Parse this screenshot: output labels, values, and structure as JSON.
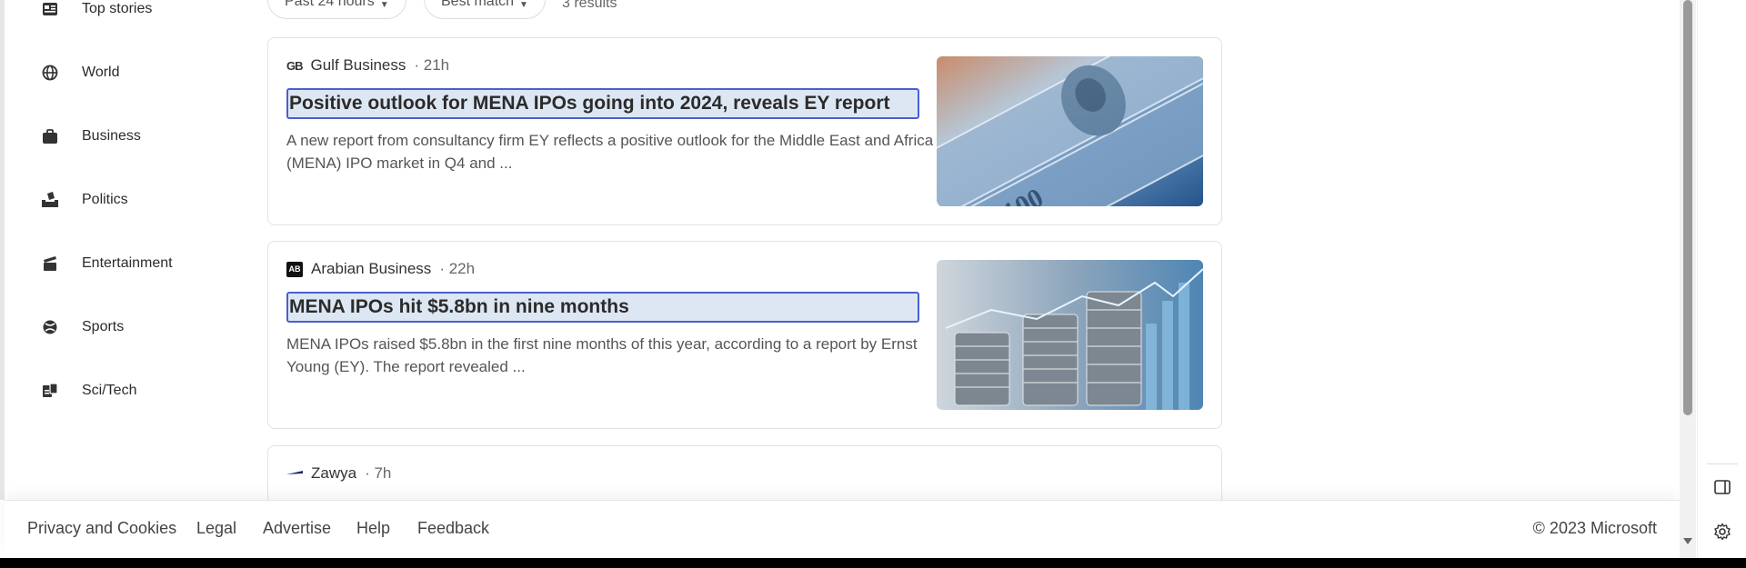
{
  "sidebar": {
    "items": [
      {
        "label": "Top stories",
        "icon": "newspaper-icon"
      },
      {
        "label": "World",
        "icon": "globe-icon"
      },
      {
        "label": "Business",
        "icon": "briefcase-icon"
      },
      {
        "label": "Politics",
        "icon": "ballot-box-icon"
      },
      {
        "label": "Entertainment",
        "icon": "clapperboard-icon"
      },
      {
        "label": "Sports",
        "icon": "sports-ball-icon"
      },
      {
        "label": "Sci/Tech",
        "icon": "flask-icon"
      }
    ]
  },
  "filters": {
    "time": "Past 24 hours",
    "sort": "Best match",
    "results": "3 results"
  },
  "articles": [
    {
      "source": "Gulf Business",
      "source_logo": "GB",
      "time": "· 21h",
      "title": "Positive outlook for MENA IPOs going into 2024, reveals EY report",
      "snippet": "A new report from consultancy firm EY reflects a positive outlook for the Middle East and Africa (MENA) IPO market in Q4 and ...",
      "thumbnail": "dollar-bills-image"
    },
    {
      "source": "Arabian Business",
      "source_logo": "AB",
      "time": "· 22h",
      "title": "MENA IPOs hit $5.8bn in nine months",
      "snippet": "MENA IPOs raised $5.8bn in the first nine months of this year, according to a report by Ernst Young (EY). The report revealed ...",
      "thumbnail": "coin-stacks-chart-image"
    },
    {
      "source": "Zawya",
      "time": "· 7h"
    }
  ],
  "footer": {
    "links": [
      "Privacy and Cookies",
      "Legal",
      "Advertise",
      "Help",
      "Feedback"
    ],
    "copyright": "© 2023 Microsoft"
  },
  "rail": {
    "icons": [
      "sidebar-panel-icon",
      "gear-icon"
    ]
  },
  "colors": {
    "title_highlight_bg": "#dde7f3",
    "title_focus_border": "#4a5fd1"
  }
}
